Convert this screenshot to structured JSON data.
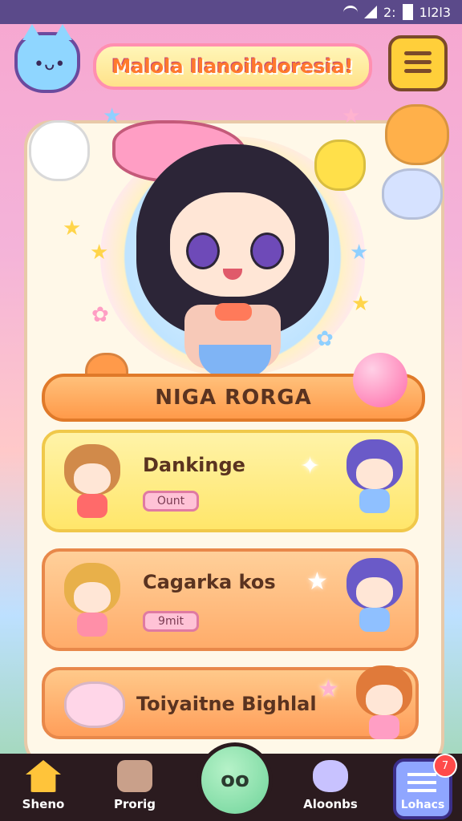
{
  "status_bar": {
    "time": "2:",
    "text": "1l2l3"
  },
  "header": {
    "title": "Malola Ilanoihdoresia!"
  },
  "banner": {
    "label": "NIGA RORGA"
  },
  "rows": [
    {
      "name": "Dankinge",
      "pill": "Ount"
    },
    {
      "name": "Cagarka kos",
      "pill": "9mit"
    },
    {
      "name": "Toiyaitne Bighlal"
    }
  ],
  "nav": {
    "items": [
      {
        "label": "Sheno"
      },
      {
        "label": "Prorig"
      },
      {
        "label": "Aloonbs"
      },
      {
        "label": "Lohacs"
      }
    ],
    "play_label": "oo",
    "badge": "7"
  }
}
